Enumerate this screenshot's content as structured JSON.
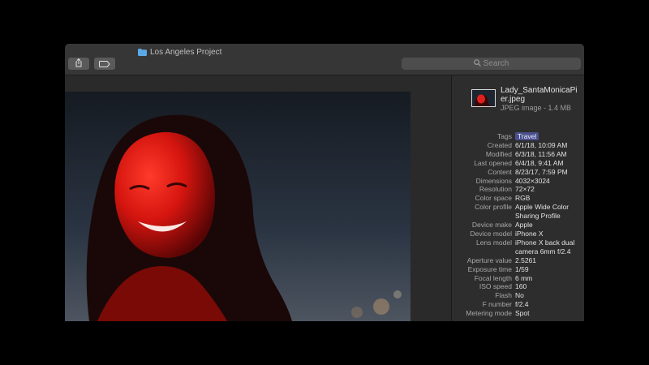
{
  "window": {
    "title": "Los Angeles Project",
    "search_placeholder": "Search"
  },
  "file": {
    "name": "Lady_SantaMonicaPier.jpeg",
    "kind": "JPEG image - 1.4 MB"
  },
  "metadata": [
    {
      "label": "Tags",
      "value": "Travel",
      "is_tag": true
    },
    {
      "label": "Created",
      "value": "6/1/18, 10:09 AM"
    },
    {
      "label": "Modified",
      "value": "6/3/18, 11:56 AM"
    },
    {
      "label": "Last opened",
      "value": "6/4/18, 9:41 AM"
    },
    {
      "label": "Content",
      "value": "8/23/17, 7:59 PM"
    },
    {
      "label": "Dimensions",
      "value": "4032×3024"
    },
    {
      "label": "Resolution",
      "value": "72×72"
    },
    {
      "label": "Color space",
      "value": "RGB"
    },
    {
      "label": "Color profile",
      "value": "Apple Wide Color Sharing Profile"
    },
    {
      "label": "Device make",
      "value": "Apple"
    },
    {
      "label": "Device model",
      "value": "iPhone X"
    },
    {
      "label": "Lens model",
      "value": "iPhone X back dual camera 6mm f/2.4"
    },
    {
      "label": "Aperture value",
      "value": "2.5261"
    },
    {
      "label": "Exposure time",
      "value": "1/59"
    },
    {
      "label": "Focal length",
      "value": "6 mm"
    },
    {
      "label": "ISO speed",
      "value": "160"
    },
    {
      "label": "Flash",
      "value": "No"
    },
    {
      "label": "F number",
      "value": "f/2.4"
    },
    {
      "label": "Metering mode",
      "value": "Spot"
    }
  ],
  "colors": {
    "tag_accent": "#4a4f8c",
    "folder": "#5aa9e6",
    "portrait_light": "#e0201c"
  },
  "icons": {
    "share": "share-icon",
    "tag": "tag-icon",
    "search": "search-icon",
    "folder": "folder-icon"
  }
}
